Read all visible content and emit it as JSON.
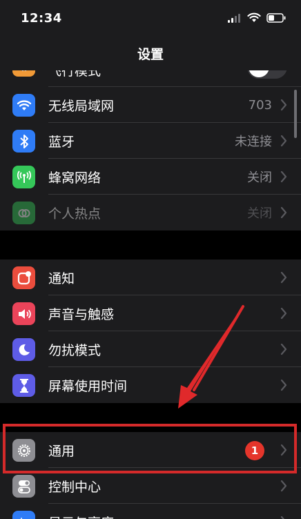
{
  "status_bar": {
    "time": "12:34"
  },
  "nav": {
    "title": "设置"
  },
  "group1": [
    {
      "label": "飞行模式",
      "value": "",
      "icon": "airplane-icon",
      "color": "#f19a37",
      "kind": "toggle"
    },
    {
      "label": "无线局域网",
      "value": "703",
      "icon": "wifi-icon",
      "color": "#2f7cf6",
      "kind": "value"
    },
    {
      "label": "蓝牙",
      "value": "未连接",
      "icon": "bluetooth-icon",
      "color": "#2f7cf6",
      "kind": "value"
    },
    {
      "label": "蜂窝网络",
      "value": "关闭",
      "icon": "antenna-icon",
      "color": "#35c759",
      "kind": "value"
    },
    {
      "label": "个人热点",
      "value": "关闭",
      "icon": "hotspot-icon",
      "color": "#35c759",
      "kind": "value",
      "dimmed": true
    }
  ],
  "group2": [
    {
      "label": "通知",
      "icon": "notification-icon",
      "color": "#eb4d3d"
    },
    {
      "label": "声音与触感",
      "icon": "speaker-icon",
      "color": "#eb445a"
    },
    {
      "label": "勿扰模式",
      "icon": "moon-icon",
      "color": "#5e5ce6"
    },
    {
      "label": "屏幕使用时间",
      "icon": "hourglass-icon",
      "color": "#5e5ce6"
    }
  ],
  "group3": [
    {
      "label": "通用",
      "icon": "gear-icon",
      "color": "#8e8e93",
      "badge": "1"
    },
    {
      "label": "控制中心",
      "icon": "toggles-icon",
      "color": "#8e8e93"
    },
    {
      "label": "显示与亮度",
      "icon": "display-icon",
      "color": "#2f7cf6"
    }
  ]
}
